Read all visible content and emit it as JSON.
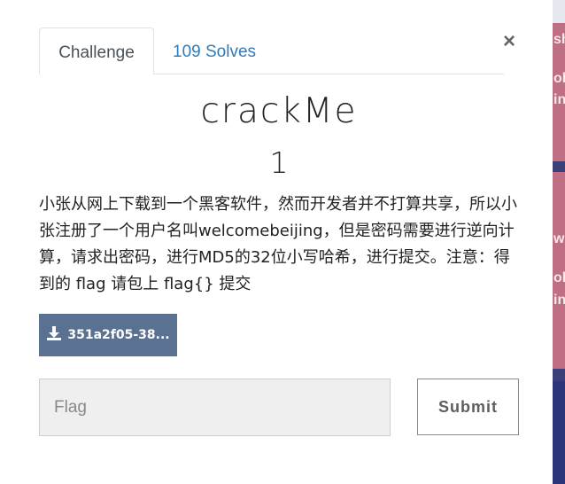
{
  "background": {
    "fragments": [
      "sh",
      "ol",
      "in",
      "wa",
      "ol",
      "in"
    ]
  },
  "tabs": {
    "challenge": "Challenge",
    "solves": "109 Solves"
  },
  "close_glyph": "×",
  "challenge": {
    "name": "crackMe",
    "value": "1",
    "description": "小张从网上下载到一个黑客软件，然而开发者并不打算共享，所以小张注册了一个用户名叫welcomebeijing，但是密码需要进行逆向计算，请求出密码，进行MD5的32位小写哈希，进行提交。注意：得到的 flag 请包上 flag{} 提交"
  },
  "file": {
    "label": "351a2f05-38...",
    "icon": "download-icon"
  },
  "form": {
    "flag_placeholder": "Flag",
    "flag_value": "",
    "submit_label": "Submit"
  }
}
